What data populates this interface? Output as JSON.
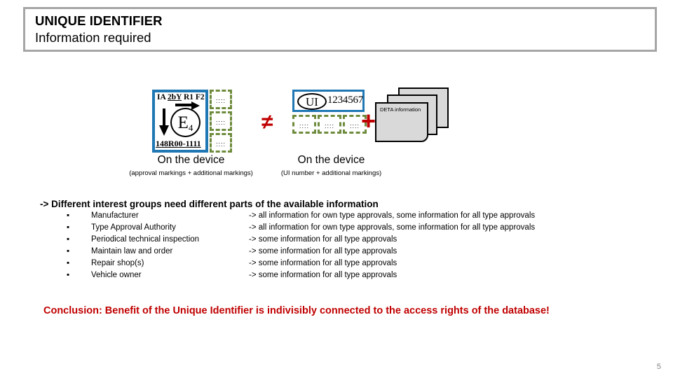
{
  "header": {
    "title": "UNIQUE IDENTIFIER",
    "subtitle": "Information required"
  },
  "diagram": {
    "approval_marking": {
      "top_line_prefix": "IA ",
      "top_line_underlined": "2bY",
      "top_line_suffix": " R1 F2",
      "circle_letter": "E",
      "circle_subscript": "4",
      "bottom_line": "148R00-1111",
      "arrow_down_icon": "down-arrow-icon",
      "arrow_right_icon": "right-arrow-icon"
    },
    "left_dashed_marks": [
      "::::",
      "::::",
      "::::"
    ],
    "operator_not_equal": "≠",
    "operator_plus": "+",
    "ui_block": {
      "oval_label": "UI",
      "number": "1234567"
    },
    "right_dashed_marks": [
      "::::",
      "::::",
      "::::"
    ],
    "document_stack_label": "DETA information",
    "captions": {
      "left_main": "On the device",
      "left_sub": "(approval markings + additional markings)",
      "right_main": "On the device",
      "right_sub": "(UI number + additional markings)"
    }
  },
  "interest_groups": {
    "intro": "-> Different interest groups need different parts of the available information",
    "bullet": "▪",
    "rows": [
      {
        "group": "Manufacturer",
        "desc": "-> all information for own type approvals, some information for all type approvals"
      },
      {
        "group": "Type Approval Authority",
        "desc": "-> all information for own type approvals, some information for all type approvals"
      },
      {
        "group": "Periodical technical inspection",
        "desc": "-> some information for all type approvals"
      },
      {
        "group": "Maintain law and order",
        "desc": "-> some information for all type approvals"
      },
      {
        "group": "Repair shop(s)",
        "desc": "-> some information for all type approvals"
      },
      {
        "group": "Vehicle owner",
        "desc": "-> some information for all type approvals"
      }
    ]
  },
  "conclusion": "Conclusion: Benefit of the Unique Identifier is indivisibly connected to the access rights of the database!",
  "page_number": "5",
  "colors": {
    "accent_blue": "#1f77b4",
    "dashed_green": "#6e8b3d",
    "red": "#c00000",
    "header_border": "#a6a6a6",
    "doc_fill": "#d9d9d9"
  }
}
